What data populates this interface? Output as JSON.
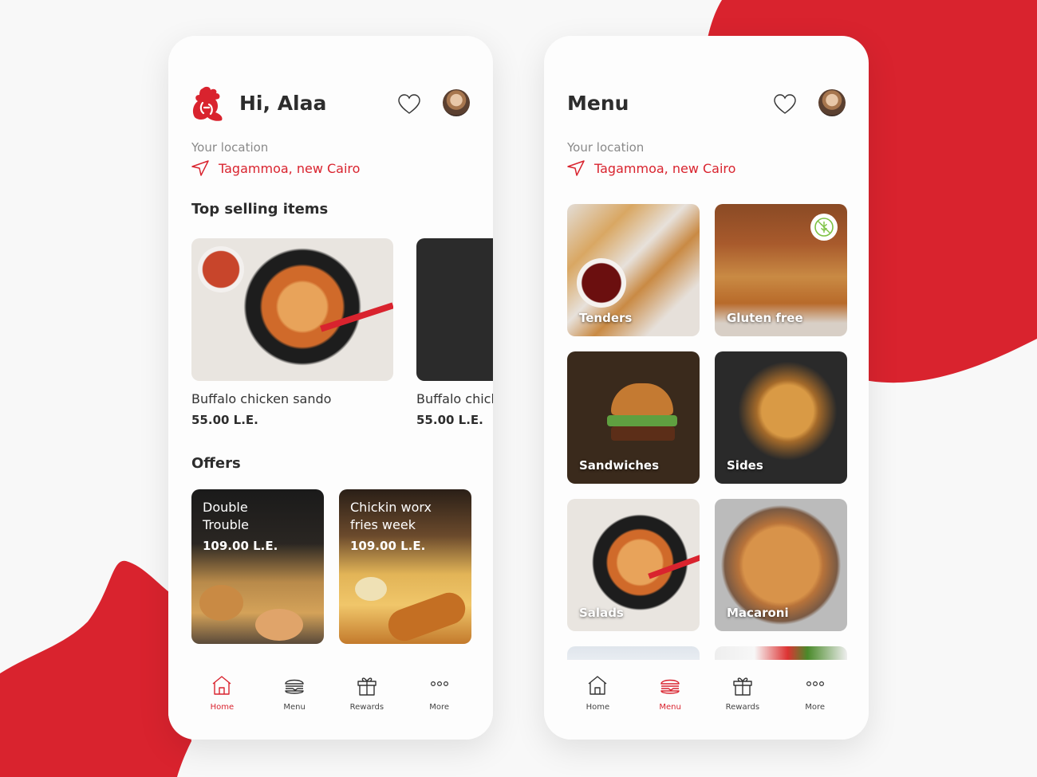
{
  "colors": {
    "brand_red": "#d9232e",
    "text_dark": "#2d2d2d",
    "text_muted": "#8a8a8a",
    "gluten_green": "#7dc243"
  },
  "home": {
    "greeting": "Hi, Alaa",
    "location_label": "Your location",
    "location_value": "Tagammoa, new Cairo",
    "top_selling_title": "Top selling items",
    "top_items": [
      {
        "name": "Buffalo chicken sando",
        "price": "55.00 L.E."
      },
      {
        "name": "Buffalo chicken",
        "price": "55.00 L.E."
      }
    ],
    "offers_title": "Offers",
    "offers": [
      {
        "title_line1": "Double",
        "title_line2": "Trouble",
        "price": "109.00 L.E."
      },
      {
        "title_line1": "Chickin worx",
        "title_line2": "fries week",
        "price": "109.00 L.E."
      }
    ]
  },
  "menu": {
    "title": "Menu",
    "location_label": "Your location",
    "location_value": "Tagammoa, new Cairo",
    "categories": [
      {
        "label": "Tenders"
      },
      {
        "label": "Gluten free",
        "badge": "gluten-free-icon"
      },
      {
        "label": "Sandwiches"
      },
      {
        "label": "Sides"
      },
      {
        "label": "Salads"
      },
      {
        "label": "Macaroni"
      }
    ]
  },
  "tabbar": {
    "items": [
      {
        "label": "Home",
        "icon": "home-icon"
      },
      {
        "label": "Menu",
        "icon": "burger-icon"
      },
      {
        "label": "Rewards",
        "icon": "gift-icon"
      },
      {
        "label": "More",
        "icon": "more-dots-icon"
      }
    ],
    "home_active": "Home",
    "menu_active": "Menu"
  }
}
